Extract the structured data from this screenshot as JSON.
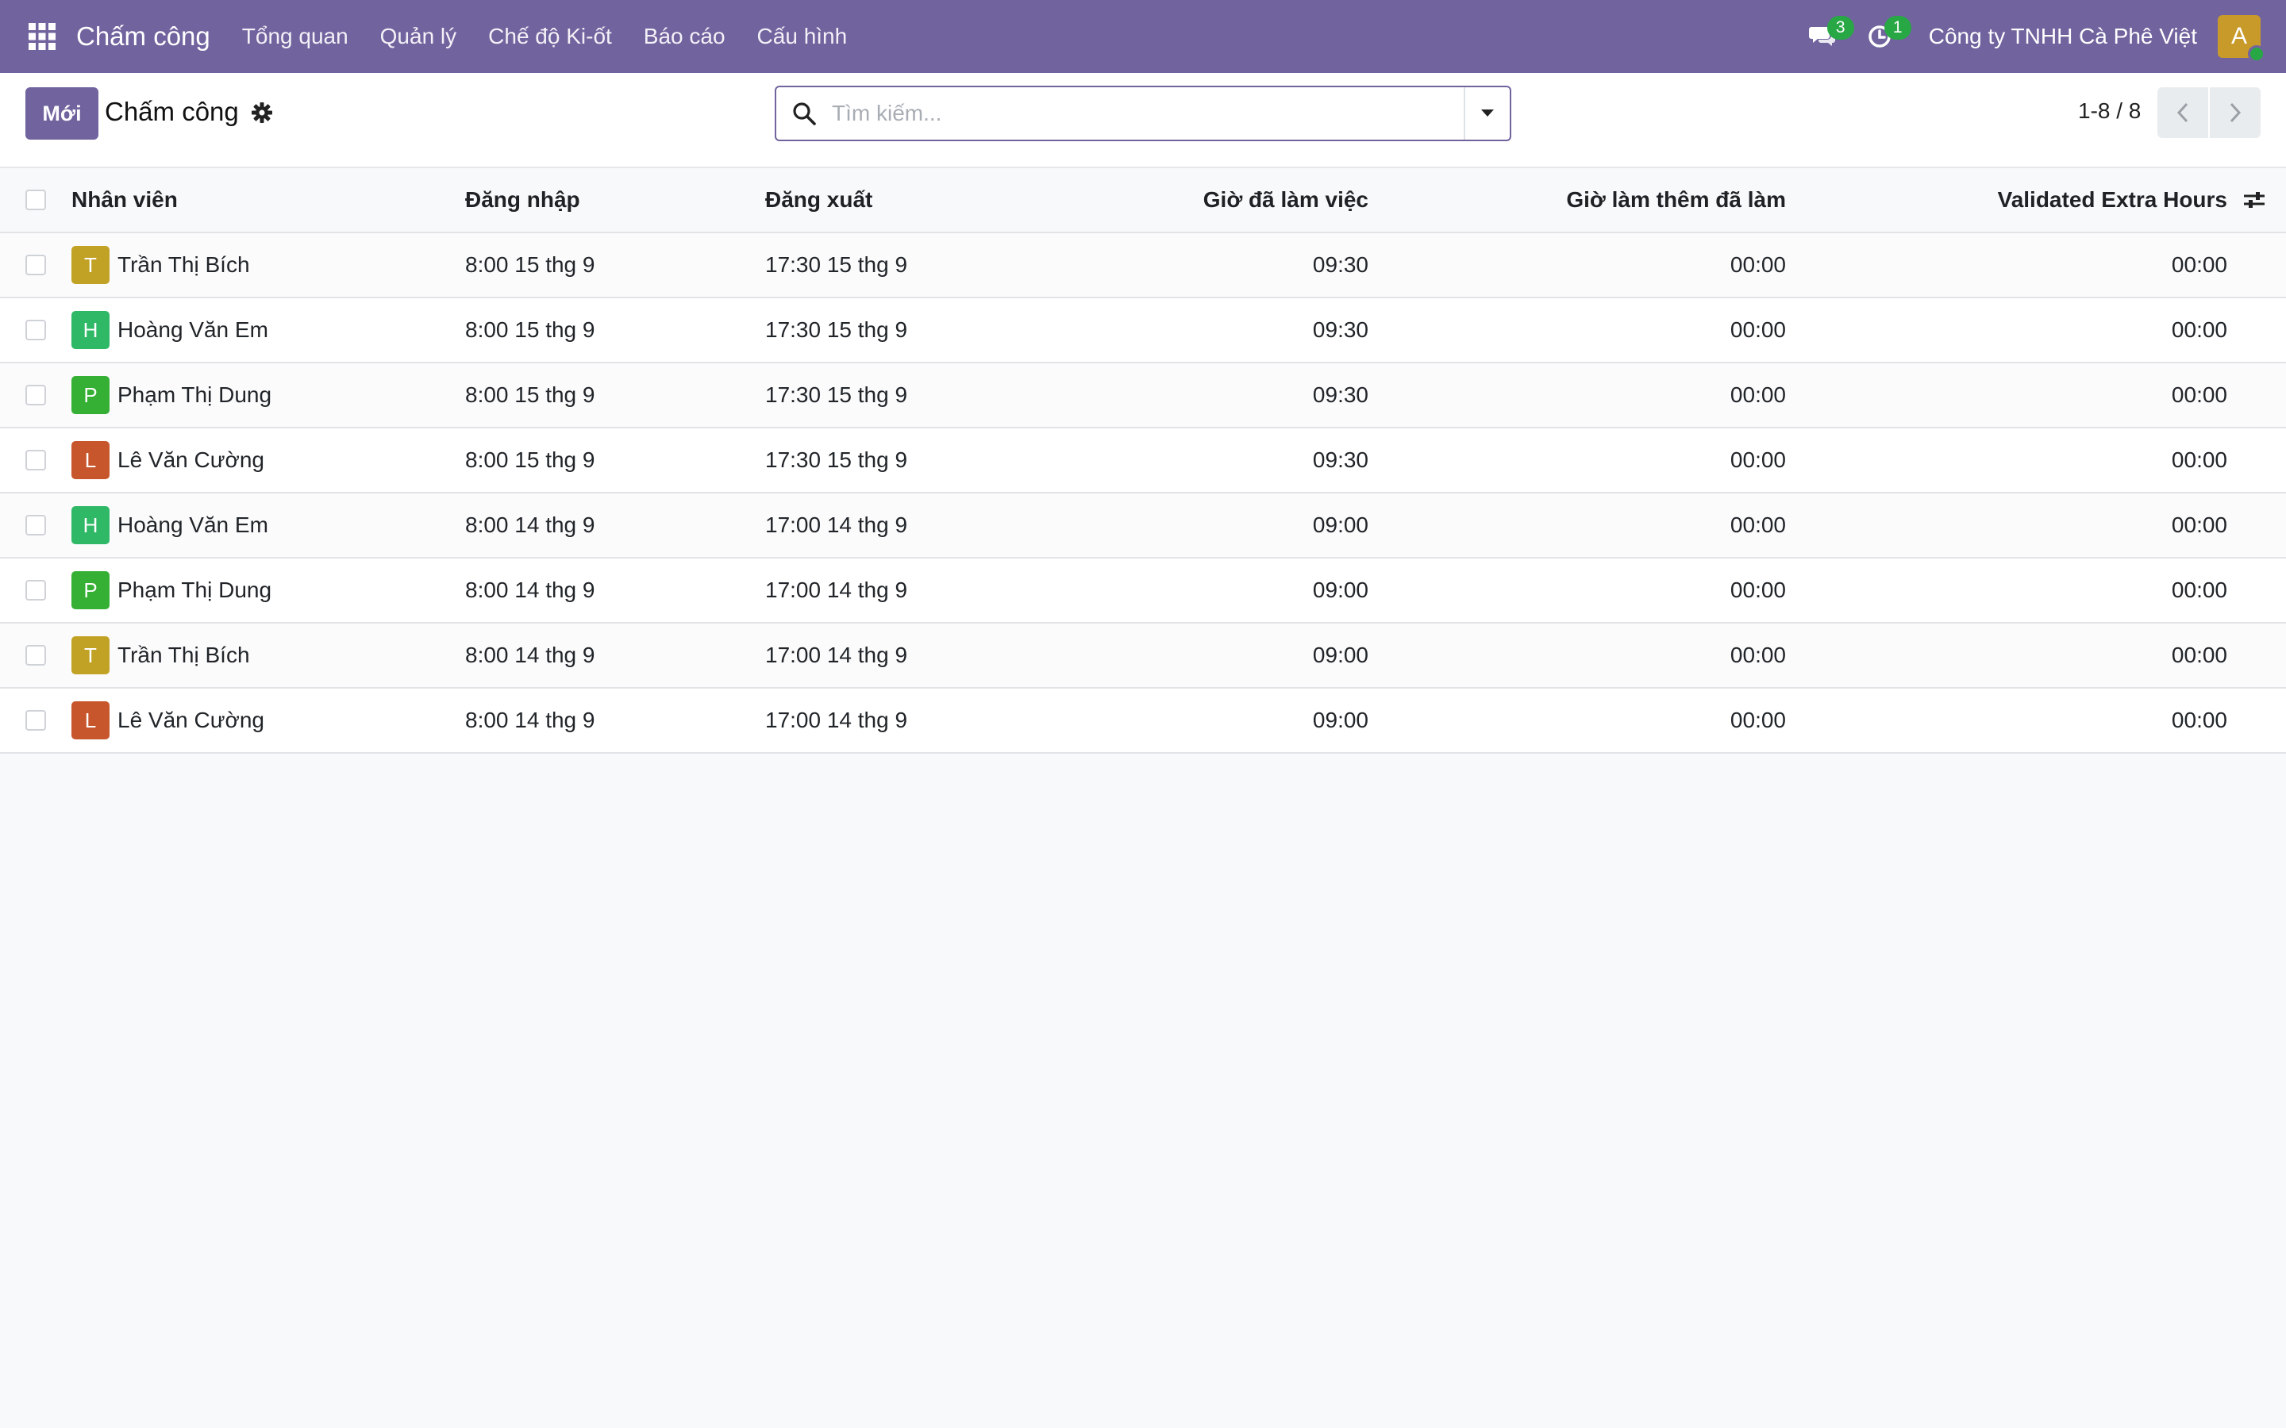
{
  "navbar": {
    "app_name": "Chấm công",
    "menu": [
      "Tổng quan",
      "Quản lý",
      "Chế độ Ki-ốt",
      "Báo cáo",
      "Cấu hình"
    ],
    "messages_count": "3",
    "activities_count": "1",
    "company": "Công ty TNHH Cà Phê Việt",
    "user_initial": "A",
    "user_avatar_color": "#c79a2a"
  },
  "control_panel": {
    "new_label": "Mới",
    "title": "Chấm công",
    "search_placeholder": "Tìm kiếm...",
    "pager_value": "1-8 / 8"
  },
  "table": {
    "headers": {
      "employee": "Nhân viên",
      "check_in": "Đăng nhập",
      "check_out": "Đăng xuất",
      "worked_hours": "Giờ đã làm việc",
      "overtime_hours": "Giờ làm thêm đã làm",
      "validated_extra_hours": "Validated Extra Hours"
    },
    "rows": [
      {
        "initial": "T",
        "color": "#c2a225",
        "employee": "Trần Thị Bích",
        "check_in": "8:00 15 thg 9",
        "check_out": "17:30 15 thg 9",
        "worked": "09:30",
        "overtime": "00:00",
        "validated": "00:00"
      },
      {
        "initial": "H",
        "color": "#2fb866",
        "employee": "Hoàng Văn Em",
        "check_in": "8:00 15 thg 9",
        "check_out": "17:30 15 thg 9",
        "worked": "09:30",
        "overtime": "00:00",
        "validated": "00:00"
      },
      {
        "initial": "P",
        "color": "#35b034",
        "employee": "Phạm Thị Dung",
        "check_in": "8:00 15 thg 9",
        "check_out": "17:30 15 thg 9",
        "worked": "09:30",
        "overtime": "00:00",
        "validated": "00:00"
      },
      {
        "initial": "L",
        "color": "#c8562c",
        "employee": "Lê Văn Cường",
        "check_in": "8:00 15 thg 9",
        "check_out": "17:30 15 thg 9",
        "worked": "09:30",
        "overtime": "00:00",
        "validated": "00:00"
      },
      {
        "initial": "H",
        "color": "#2fb866",
        "employee": "Hoàng Văn Em",
        "check_in": "8:00 14 thg 9",
        "check_out": "17:00 14 thg 9",
        "worked": "09:00",
        "overtime": "00:00",
        "validated": "00:00"
      },
      {
        "initial": "P",
        "color": "#35b034",
        "employee": "Phạm Thị Dung",
        "check_in": "8:00 14 thg 9",
        "check_out": "17:00 14 thg 9",
        "worked": "09:00",
        "overtime": "00:00",
        "validated": "00:00"
      },
      {
        "initial": "T",
        "color": "#c2a225",
        "employee": "Trần Thị Bích",
        "check_in": "8:00 14 thg 9",
        "check_out": "17:00 14 thg 9",
        "worked": "09:00",
        "overtime": "00:00",
        "validated": "00:00"
      },
      {
        "initial": "L",
        "color": "#c8562c",
        "employee": "Lê Văn Cường",
        "check_in": "8:00 14 thg 9",
        "check_out": "17:00 14 thg 9",
        "worked": "09:00",
        "overtime": "00:00",
        "validated": "00:00"
      }
    ]
  }
}
